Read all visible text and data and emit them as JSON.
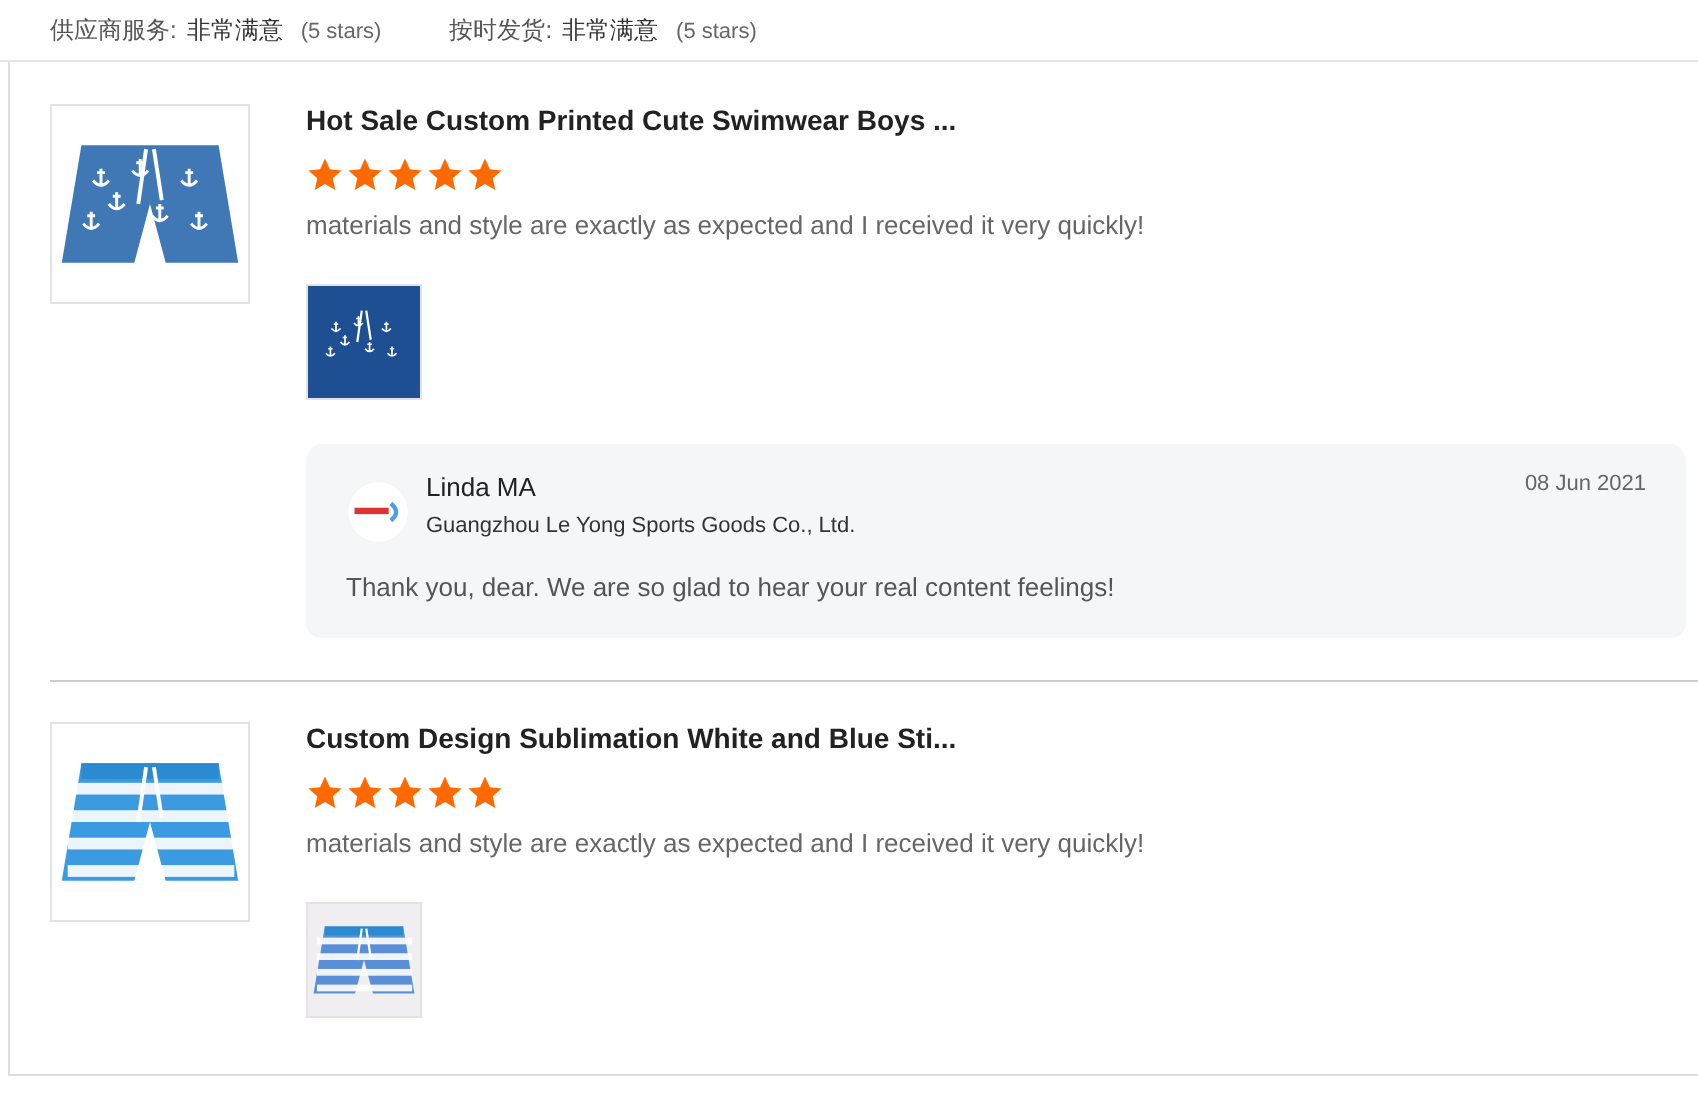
{
  "ratings": [
    {
      "label": "供应商服务:",
      "value": "非常满意",
      "note": "(5 stars)"
    },
    {
      "label": "按时发货:",
      "value": "非常满意",
      "note": "(5 stars)"
    }
  ],
  "reviews": [
    {
      "product": "Hot Sale Custom Printed Cute Swimwear Boys ...",
      "kind": "anchors",
      "stars": 5,
      "text": "materials and style are exactly as expected and I received it very quickly!",
      "reply": {
        "name": "Linda MA",
        "company": "Guangzhou Le Yong Sports Goods Co., Ltd.",
        "date": "08 Jun 2021",
        "text": "Thank you, dear. We are so glad to hear your real content feelings!"
      }
    },
    {
      "product": "Custom Design Sublimation White and Blue Sti...",
      "kind": "stripes",
      "stars": 5,
      "text": "materials and style are exactly as expected and I received it very quickly!"
    }
  ]
}
